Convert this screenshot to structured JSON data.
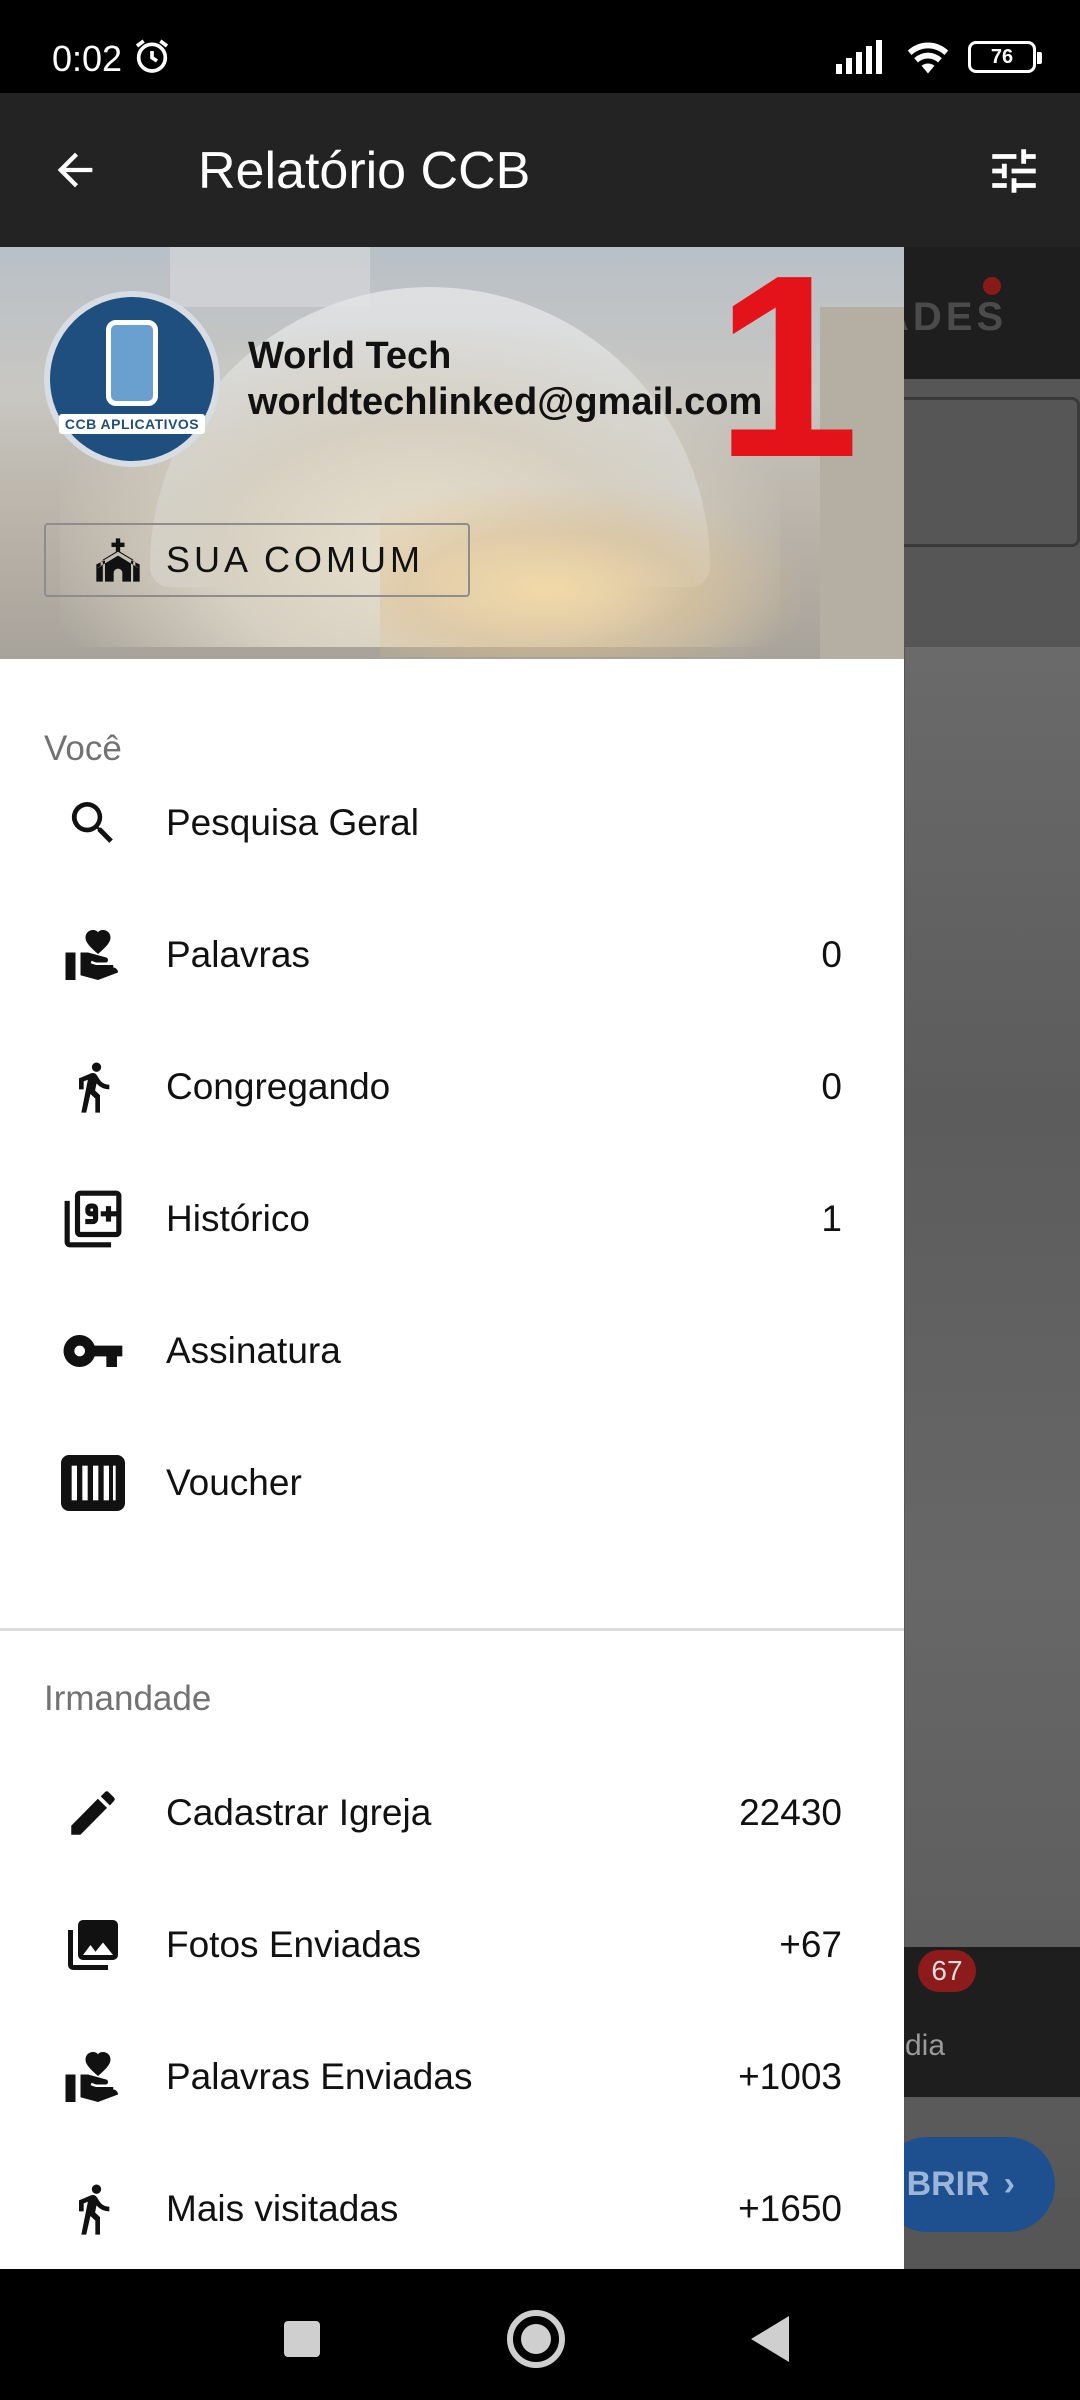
{
  "status_bar": {
    "time": "0:02",
    "battery": "76"
  },
  "toolbar": {
    "title": "Relatório CCB"
  },
  "background": {
    "tab_text": "ADES",
    "badge": "67",
    "bottom_label": "dia",
    "open_button": "BRIR"
  },
  "drawer": {
    "avatar_text": "CCB APLICATIVOS",
    "user_name": "World Tech",
    "user_email": "worldtechlinked@gmail.com",
    "big_number": "1",
    "comum_button": "SUA COMUM",
    "section_you": "Você",
    "section_brotherhood": "Irmandade",
    "items": [
      {
        "label": "Pesquisa Geral",
        "count": "",
        "icon": "search-icon"
      },
      {
        "label": "Palavras",
        "count": "0",
        "icon": "hand-heart-icon"
      },
      {
        "label": "Congregando",
        "count": "0",
        "icon": "walking-person-icon"
      },
      {
        "label": "Histórico",
        "count": "1",
        "icon": "filter-9-plus-icon"
      },
      {
        "label": "Assinatura",
        "count": "",
        "icon": "key-icon"
      },
      {
        "label": "Voucher",
        "count": "",
        "icon": "barcode-icon"
      },
      {
        "label": "Cadastrar Igreja",
        "count": "22430",
        "icon": "pencil-icon"
      },
      {
        "label": "Fotos Enviadas",
        "count": "+67",
        "icon": "photo-library-icon"
      },
      {
        "label": "Palavras Enviadas",
        "count": "+1003",
        "icon": "hand-heart-icon"
      },
      {
        "label": "Mais visitadas",
        "count": "+1650",
        "icon": "walking-person-icon"
      }
    ]
  }
}
